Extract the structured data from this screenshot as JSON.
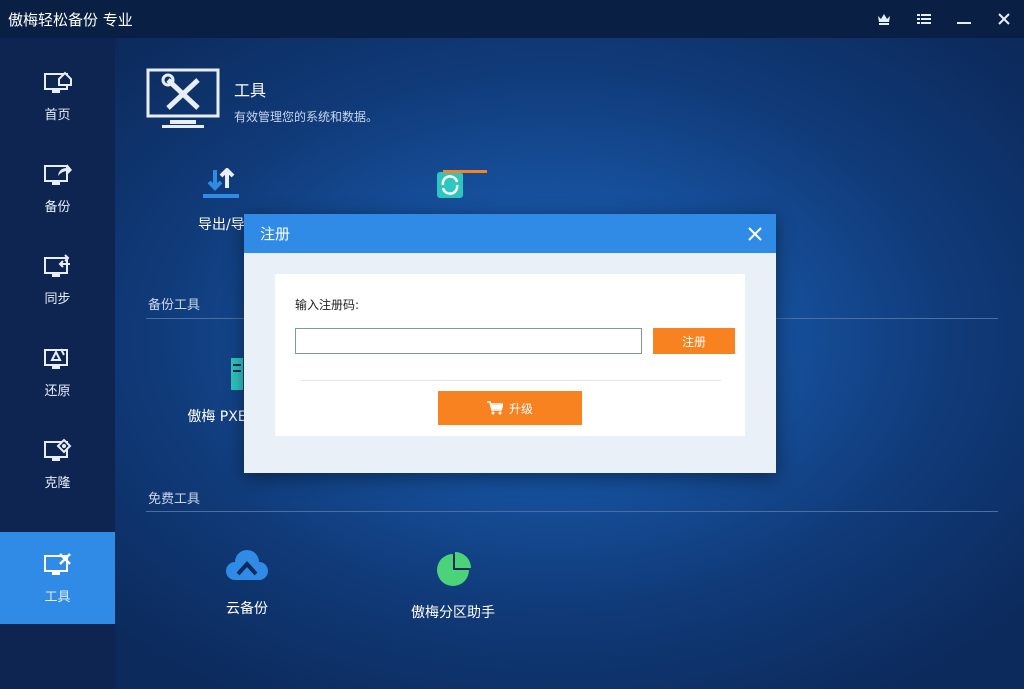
{
  "app": {
    "title": "傲梅轻松备份 专业"
  },
  "sidebar": {
    "items": [
      {
        "label": "首页",
        "icon": "home-monitor-icon"
      },
      {
        "label": "备份",
        "icon": "backup-monitor-icon"
      },
      {
        "label": "同步",
        "icon": "sync-monitor-icon"
      },
      {
        "label": "还原",
        "icon": "restore-monitor-icon"
      },
      {
        "label": "克隆",
        "icon": "clone-monitor-icon"
      },
      {
        "label": "工具",
        "icon": "tools-monitor-icon",
        "active": true
      }
    ]
  },
  "header": {
    "title": "工具",
    "subtitle": "有效管理您的系统和数据。"
  },
  "sections": {
    "backup_tools": "备份工具",
    "free_tools": "免费工具"
  },
  "tools": {
    "export_import": "导出/导",
    "pxe": "傲梅 PXE",
    "cloud_backup": "云备份",
    "partition_assistant": "傲梅分区助手"
  },
  "dialog": {
    "title": "注册",
    "input_label": "输入注册码:",
    "input_value": "",
    "register_button": "注册",
    "upgrade_button": "升级"
  },
  "colors": {
    "accent_blue": "#2f8be6",
    "orange": "#f7821f",
    "cloud_blue": "#2f8be6",
    "pie_green": "#4cd37a",
    "teal": "#2ec7c0"
  }
}
